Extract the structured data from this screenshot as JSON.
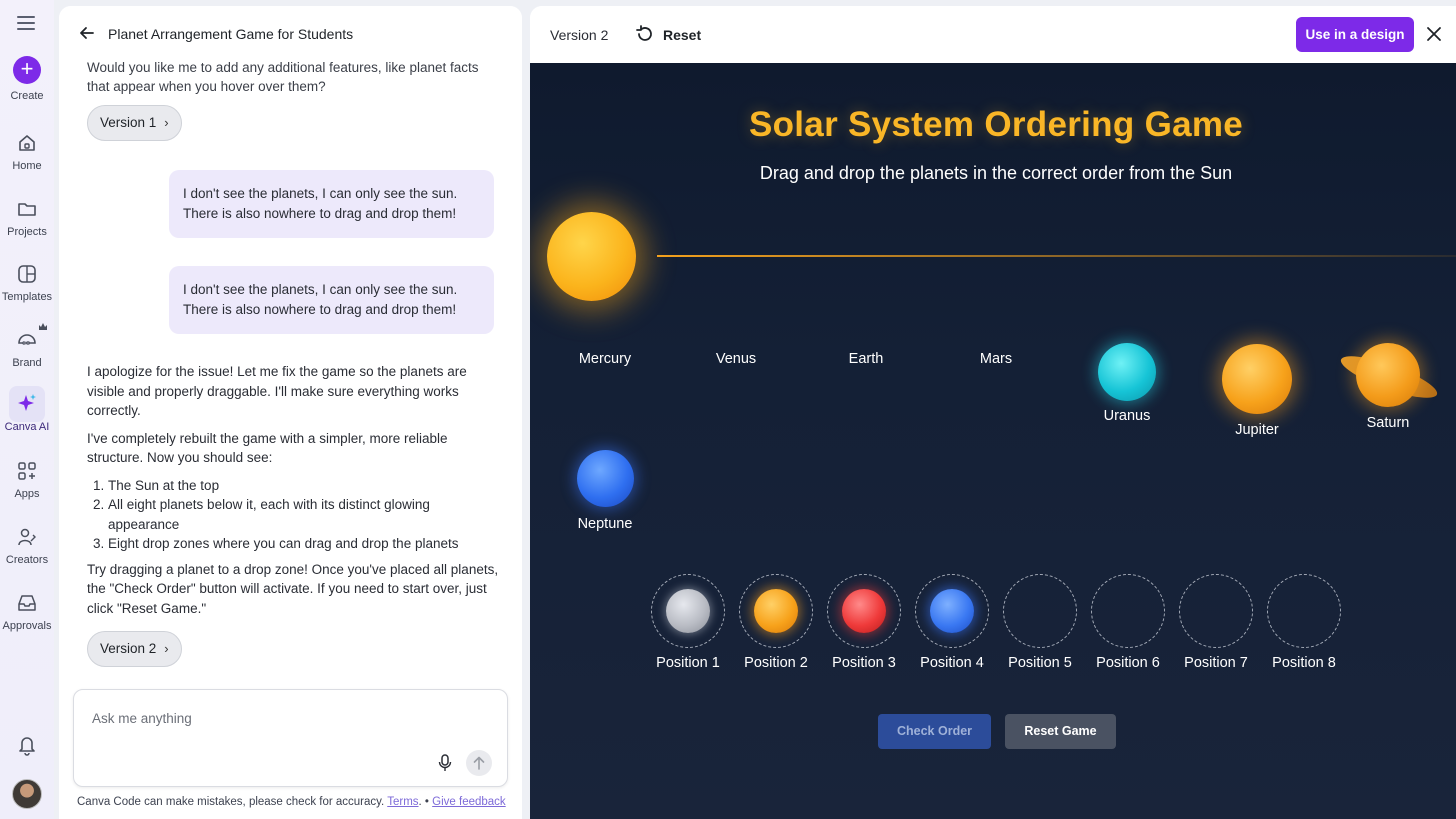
{
  "rail": {
    "create": "Create",
    "home": "Home",
    "projects": "Projects",
    "templates": "Templates",
    "brand": "Brand",
    "canva_ai": "Canva AI",
    "apps": "Apps",
    "creators": "Creators",
    "approvals": "Approvals"
  },
  "chat": {
    "title": "Planet Arrangement Game for Students",
    "faded_intro": "Would you like me to add any additional features, like planet facts that appear when you hover over them?",
    "version1": "Version 1",
    "user_msg_1": "I don't see the planets, I can only see the sun. There is also nowhere to drag and drop them!",
    "user_msg_2": "I don't see the planets, I can only see the sun. There is also nowhere to drag and drop them!",
    "assistant_p1": "I apologize for the issue! Let me fix the game so the planets are visible and properly draggable. I'll make sure everything works correctly.",
    "assistant_p2": "I've completely rebuilt the game with a simpler, more reliable structure. Now you should see:",
    "list": [
      "The Sun at the top",
      "All eight planets below it, each with its distinct glowing appearance",
      "Eight drop zones where you can drag and drop the planets"
    ],
    "assistant_p3": "Try dragging a planet to a drop zone! Once you've placed all planets, the \"Check Order\" button will activate. If you need to start over, just click \"Reset Game.\"",
    "version2": "Version 2",
    "input_placeholder": "Ask me anything",
    "disclaimer_text": "Canva Code can make mistakes, please check for accuracy.",
    "terms": "Terms",
    "separator": ".  •",
    "feedback": "Give feedback"
  },
  "preview": {
    "version_label": "Version 2",
    "reset_label": "Reset",
    "use_button": "Use in a design"
  },
  "game": {
    "title": "Solar System Ordering Game",
    "subtitle": "Drag and drop the planets in the correct order from the Sun",
    "planets_unplaced": [
      "Mercury",
      "Venus",
      "Earth",
      "Mars",
      "Uranus",
      "Jupiter",
      "Saturn",
      "Neptune"
    ],
    "positions": [
      "Position 1",
      "Position 2",
      "Position 3",
      "Position 4",
      "Position 5",
      "Position 6",
      "Position 7",
      "Position 8"
    ],
    "placed_colors": [
      "#b9bcc4",
      "#f7a21b",
      "#ef3a3a",
      "#3a78f2"
    ],
    "check_button": "Check Order",
    "reset_button": "Reset Game"
  },
  "colors": {
    "accent": "#7d2ae8",
    "title_gold": "#f9b627"
  }
}
